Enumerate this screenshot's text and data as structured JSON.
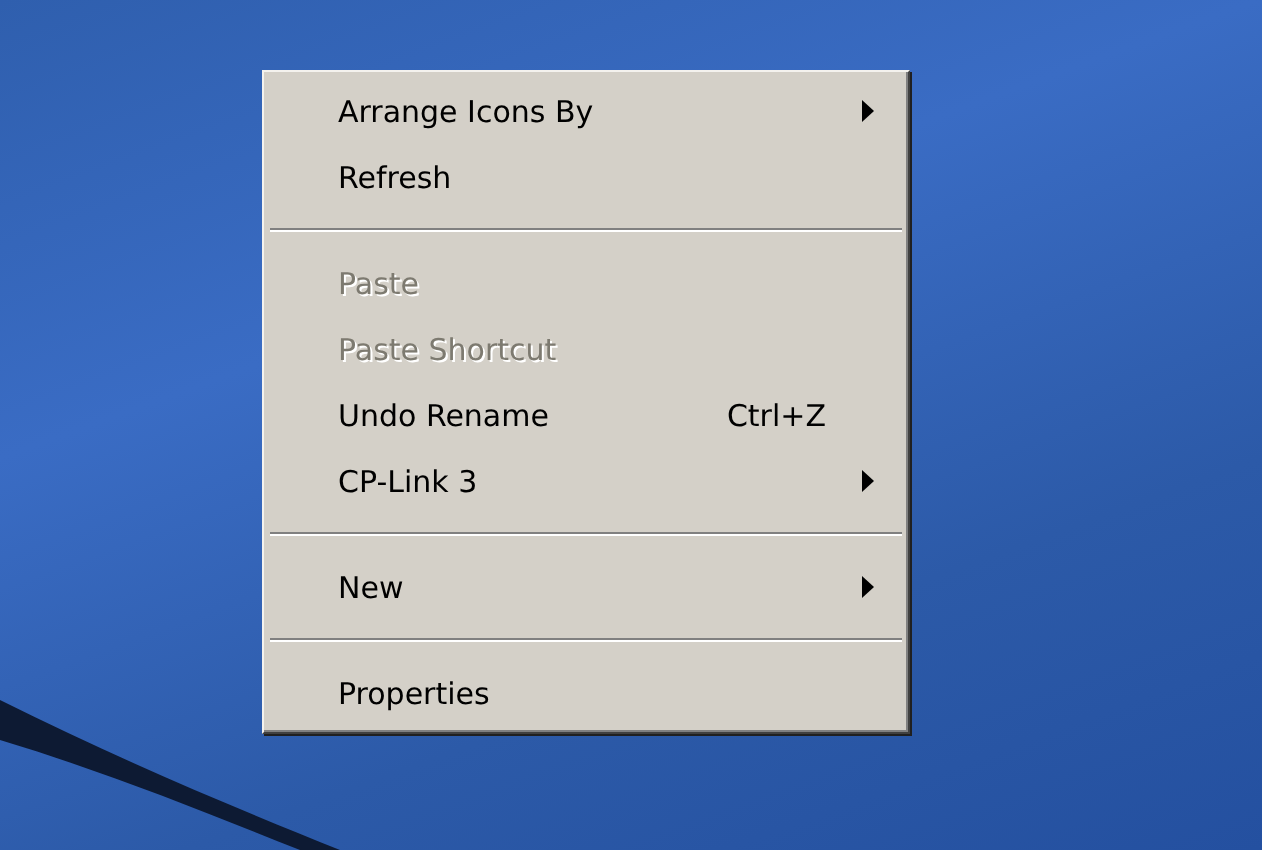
{
  "context_menu": {
    "entries": [
      {
        "kind": "item",
        "label": "Arrange Icons By",
        "disabled": false,
        "submenu": true
      },
      {
        "kind": "item",
        "label": "Refresh",
        "disabled": false,
        "submenu": false
      },
      {
        "kind": "separator"
      },
      {
        "kind": "item",
        "label": "Paste",
        "disabled": true,
        "submenu": false
      },
      {
        "kind": "item",
        "label": "Paste Shortcut",
        "disabled": true,
        "submenu": false
      },
      {
        "kind": "item",
        "label": "Undo Rename",
        "disabled": false,
        "submenu": false,
        "shortcut": "Ctrl+Z"
      },
      {
        "kind": "item",
        "label": "CP-Link 3",
        "disabled": false,
        "submenu": true
      },
      {
        "kind": "separator"
      },
      {
        "kind": "item",
        "label": "New",
        "disabled": false,
        "submenu": true
      },
      {
        "kind": "separator"
      },
      {
        "kind": "item",
        "label": "Properties",
        "disabled": false,
        "submenu": false
      }
    ]
  }
}
